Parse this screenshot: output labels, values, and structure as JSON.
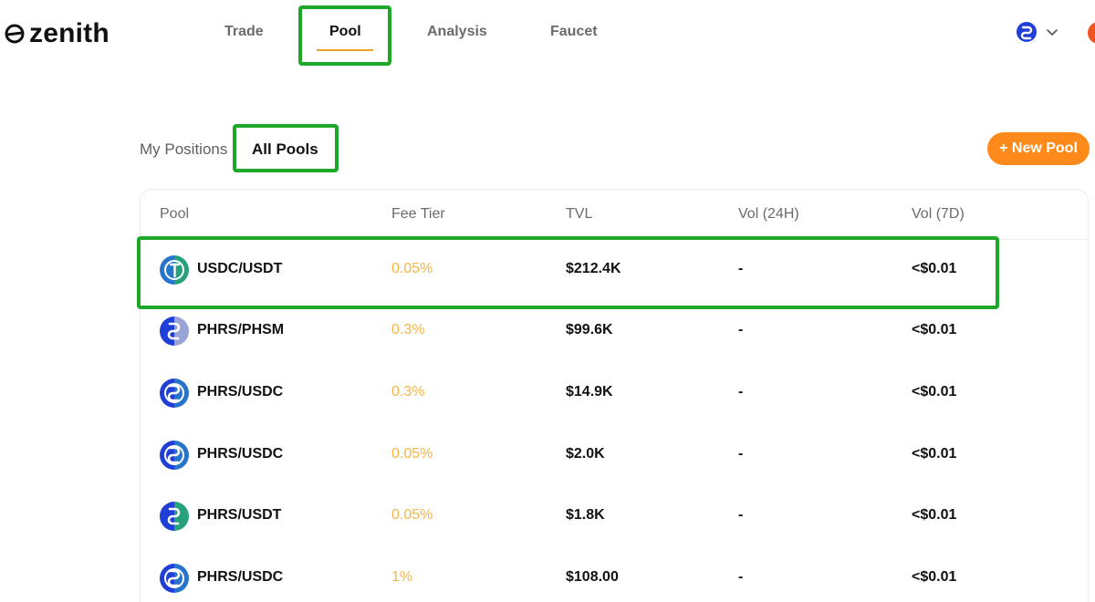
{
  "brand": {
    "name": "zenith"
  },
  "nav": {
    "items": [
      {
        "label": "Trade",
        "active": false
      },
      {
        "label": "Pool",
        "active": true
      },
      {
        "label": "Analysis",
        "active": false
      },
      {
        "label": "Faucet",
        "active": false
      }
    ]
  },
  "header": {
    "chain_icon": "phrs-chain-icon",
    "dropdown_icon": "chevron-down-icon"
  },
  "tabs": {
    "my_positions": "My Positions",
    "all_pools": "All Pools",
    "active": "all_pools"
  },
  "new_pool_button": "+ New Pool",
  "table": {
    "headers": {
      "pool": "Pool",
      "fee_tier": "Fee Tier",
      "tvl": "TVL",
      "vol_24h": "Vol (24H)",
      "vol_7d": "Vol (7D)"
    },
    "rows": [
      {
        "pair": "USDC/USDT",
        "fee": "0.05%",
        "tvl": "$212.4K",
        "vol24h": "-",
        "vol7d": "<$0.01",
        "icon": "usdc-usdt-pair-icon"
      },
      {
        "pair": "PHRS/PHSM",
        "fee": "0.3%",
        "tvl": "$99.6K",
        "vol24h": "-",
        "vol7d": "<$0.01",
        "icon": "phrs-phsm-pair-icon"
      },
      {
        "pair": "PHRS/USDC",
        "fee": "0.3%",
        "tvl": "$14.9K",
        "vol24h": "-",
        "vol7d": "<$0.01",
        "icon": "phrs-usdc-pair-icon"
      },
      {
        "pair": "PHRS/USDC",
        "fee": "0.05%",
        "tvl": "$2.0K",
        "vol24h": "-",
        "vol7d": "<$0.01",
        "icon": "phrs-usdc-pair-icon"
      },
      {
        "pair": "PHRS/USDT",
        "fee": "0.05%",
        "tvl": "$1.8K",
        "vol24h": "-",
        "vol7d": "<$0.01",
        "icon": "phrs-usdt-pair-icon"
      },
      {
        "pair": "PHRS/USDC",
        "fee": "1%",
        "tvl": "$108.00",
        "vol24h": "-",
        "vol7d": "<$0.01",
        "icon": "phrs-usdc-pair-icon"
      }
    ]
  },
  "colors": {
    "accent": "#ff8a1c",
    "fee_text": "#f5b54a",
    "highlight": "#1ea82a",
    "usdc_blue": "#2775ca",
    "usdt_green": "#26a17b",
    "phrs_blue": "#1f3fd6"
  }
}
